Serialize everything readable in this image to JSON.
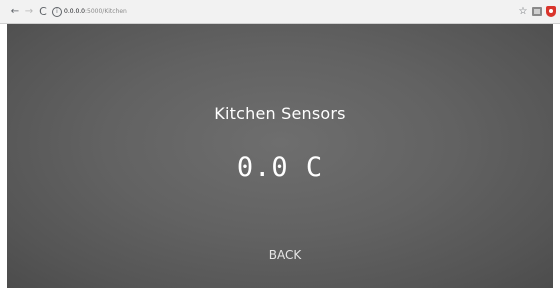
{
  "browser": {
    "back_glyph": "←",
    "forward_glyph": "→",
    "reload_glyph": "C",
    "info_glyph": "i",
    "url_host": "0.0.0.0",
    "url_path": ":5000/Kitchen",
    "star_glyph": "☆"
  },
  "page": {
    "title": "Kitchen Sensors",
    "reading": "0.0 C",
    "back_label": "BACK"
  }
}
